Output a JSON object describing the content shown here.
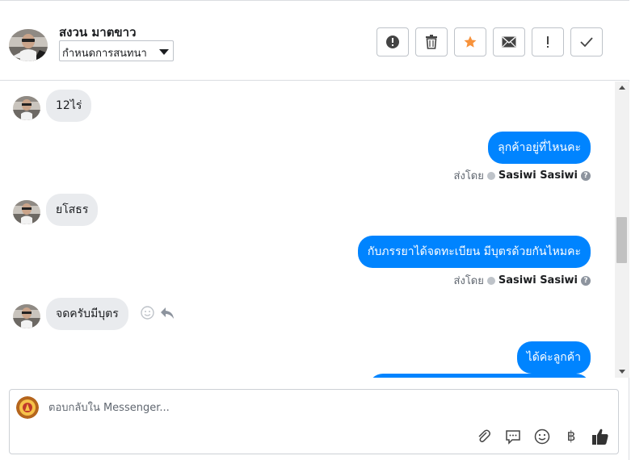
{
  "header": {
    "contact_name": "สงวน มาตขาว",
    "conversation_select": "กำหนดการสนทนา",
    "toolbar": [
      "alert-circle-icon",
      "trash-icon",
      "star-icon",
      "envelope-icon",
      "exclamation-icon",
      "check-icon"
    ],
    "star_color": "#f7923b"
  },
  "messages": [
    {
      "dir": "in",
      "text": "12ไร่"
    },
    {
      "dir": "out",
      "text": "ลุกค้าอยู่ที่ไหนคะ",
      "sent_by_label": "ส่งโดย",
      "sender": "Sasiwi Sasiwi"
    },
    {
      "dir": "in",
      "text": "ยโสธร"
    },
    {
      "dir": "out",
      "text": "กับภรรยาได้จดทะเบียน มีบุตรด้วยกันไหมคะ",
      "sent_by_label": "ส่งโดย",
      "sender": "Sasiwi Sasiwi"
    },
    {
      "dir": "in",
      "text": "จดครับมีบุตร"
    },
    {
      "dir": "out",
      "text": "ได้ค่ะลูกค้า"
    }
  ],
  "composer": {
    "placeholder": "ตอบกลับใน Messenger...",
    "icons": [
      "paperclip-icon",
      "saved-reply-icon",
      "emoji-icon",
      "baht-icon",
      "thumbs-up-icon"
    ],
    "baht_symbol": "฿"
  },
  "colors": {
    "accent": "#0084ff",
    "incoming_bubble": "#e9ebee"
  }
}
